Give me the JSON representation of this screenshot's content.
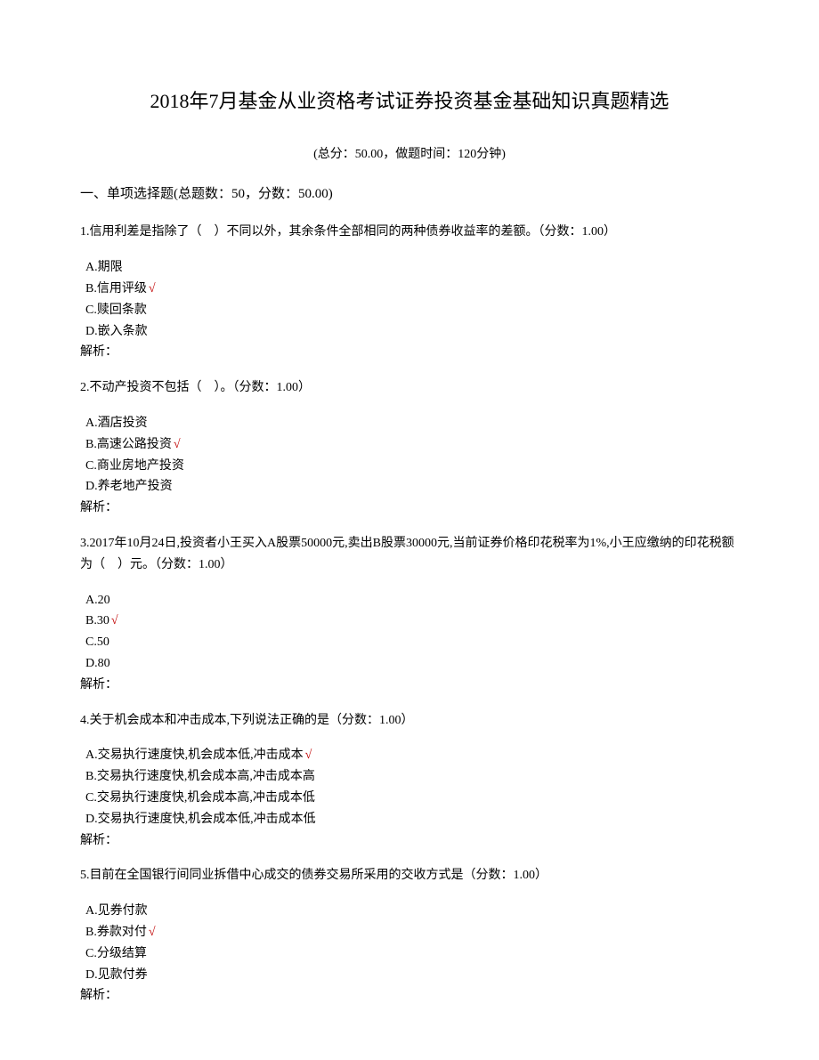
{
  "title": "2018年7月基金从业资格考试证券投资基金基础知识真题精选",
  "subtitle": "(总分：50.00，做题时间：120分钟)",
  "section_header": "一、单项选择题(总题数：50，分数：50.00)",
  "analysis_label": "解析：",
  "checkmark": "√",
  "questions": [
    {
      "text": "1.信用利差是指除了（　）不同以外，其余条件全部相同的两种债券收益率的差额。（分数：1.00）",
      "options": [
        {
          "label": "A.期限",
          "correct": false
        },
        {
          "label": "B.信用评级",
          "correct": true
        },
        {
          "label": "C.赎回条款",
          "correct": false
        },
        {
          "label": "D.嵌入条款",
          "correct": false
        }
      ]
    },
    {
      "text": "2.不动产投资不包括（　）。（分数：1.00）",
      "options": [
        {
          "label": "A.酒店投资",
          "correct": false
        },
        {
          "label": "B.高速公路投资",
          "correct": true
        },
        {
          "label": "C.商业房地产投资",
          "correct": false
        },
        {
          "label": "D.养老地产投资",
          "correct": false
        }
      ]
    },
    {
      "text": "3.2017年10月24日,投资者小王买入A股票50000元,卖出B股票30000元,当前证券价格印花税率为1%,小王应缴纳的印花税额为（　）元。（分数：1.00）",
      "options": [
        {
          "label": "A.20",
          "correct": false
        },
        {
          "label": "B.30",
          "correct": true
        },
        {
          "label": "C.50",
          "correct": false
        },
        {
          "label": "D.80",
          "correct": false
        }
      ]
    },
    {
      "text": "4.关于机会成本和冲击成本,下列说法正确的是（分数：1.00）",
      "options": [
        {
          "label": "A.交易执行速度快,机会成本低,冲击成本",
          "correct": true
        },
        {
          "label": "B.交易执行速度快,机会成本高,冲击成本高",
          "correct": false
        },
        {
          "label": "C.交易执行速度快,机会成本高,冲击成本低",
          "correct": false
        },
        {
          "label": "D.交易执行速度快,机会成本低,冲击成本低",
          "correct": false
        }
      ]
    },
    {
      "text": "5.目前在全国银行间同业拆借中心成交的债券交易所采用的交收方式是（分数：1.00）",
      "options": [
        {
          "label": "A.见券付款",
          "correct": false
        },
        {
          "label": "B.券款对付",
          "correct": true
        },
        {
          "label": "C.分级结算",
          "correct": false
        },
        {
          "label": "D.见款付券",
          "correct": false
        }
      ]
    }
  ]
}
